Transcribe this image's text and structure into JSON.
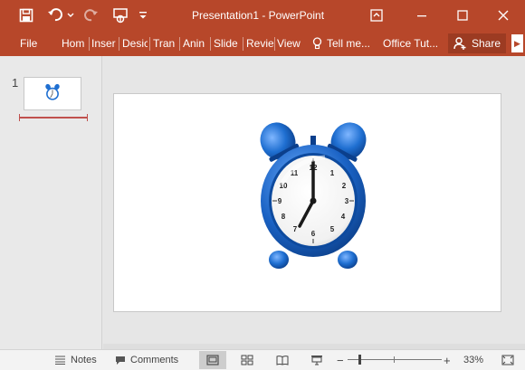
{
  "app": {
    "title": "Presentation1  -  PowerPoint"
  },
  "ribbon": {
    "file": "File",
    "tabs": [
      "Hom",
      "Inser",
      "Desic",
      "Tran",
      "Anin",
      "Slide",
      "Revie",
      "View"
    ],
    "tell_me": "Tell me...",
    "office_tut": "Office Tut...",
    "share": "Share"
  },
  "thumbnails": {
    "slide_number": "1"
  },
  "statusbar": {
    "notes": "Notes",
    "comments": "Comments",
    "zoom": "33%",
    "zoom_level": 0.33
  },
  "colors": {
    "accent": "#b7472a",
    "clock_blue": "#1f6fd1"
  }
}
